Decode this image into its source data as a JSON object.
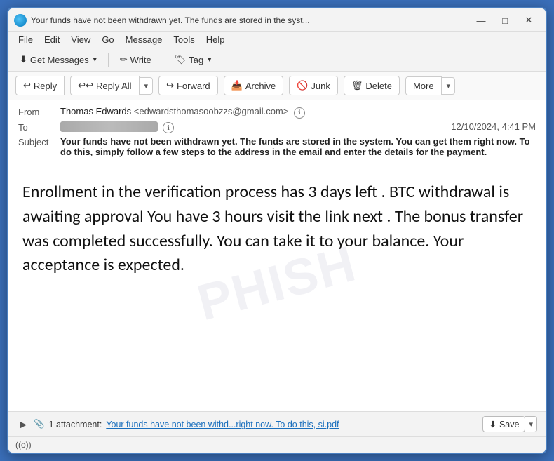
{
  "window": {
    "title": "Your funds have not been withdrawn yet. The funds are stored in the syst...",
    "icon_alt": "thunderbird-icon"
  },
  "titlebar_buttons": {
    "minimize": "—",
    "maximize": "□",
    "close": "✕"
  },
  "menubar": {
    "items": [
      "File",
      "Edit",
      "View",
      "Go",
      "Message",
      "Tools",
      "Help"
    ]
  },
  "toolbar": {
    "get_messages_label": "Get Messages",
    "write_label": "Write",
    "tag_label": "Tag"
  },
  "action_bar": {
    "reply_label": "Reply",
    "reply_all_label": "Reply All",
    "forward_label": "Forward",
    "archive_label": "Archive",
    "junk_label": "Junk",
    "delete_label": "Delete",
    "more_label": "More"
  },
  "email": {
    "from_label": "From",
    "from_name": "Thomas Edwards",
    "from_email": "<edwardsthomasoobzzs@gmail.com>",
    "to_label": "To",
    "to_value": "████████████",
    "date": "12/10/2024, 4:41 PM",
    "subject_label": "Subject",
    "subject": "Your funds have not been withdrawn yet. The funds are stored in the system. You can get them right now. To do this, simply follow a few steps to the address in the email and enter the details for the payment.",
    "body": "Enrollment in the verification process has 3 days left . BTC withdrawal is awaiting approval You have 3 hours visit the link next . The bonus transfer was completed successfully. You can take it to your balance. Your acceptance is expected."
  },
  "attachment": {
    "expand_icon": "▶",
    "attachment_icon": "📎",
    "count_label": "1 attachment:",
    "filename": "Your funds have not been withd...right now. To do this, si.pdf",
    "save_label": "Save"
  },
  "statusbar": {
    "signal_icon": "((o))"
  },
  "watermark_text": "PHISH"
}
